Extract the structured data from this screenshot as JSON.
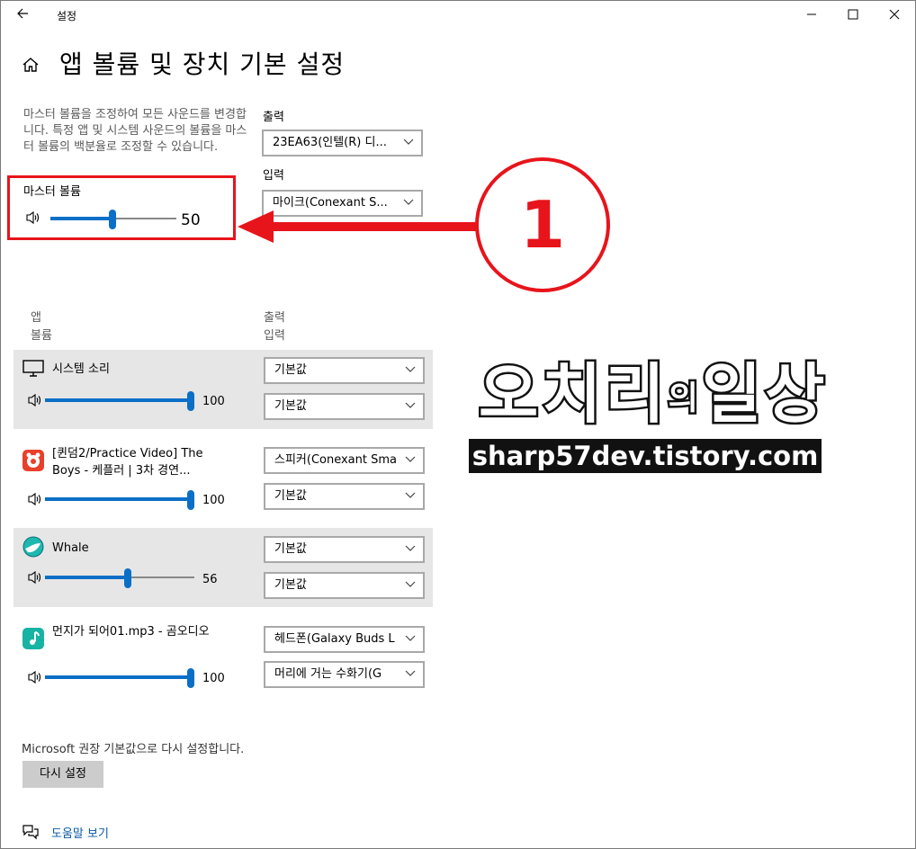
{
  "window": {
    "title": "설정",
    "back_icon": "arrow-left-icon",
    "minimize_glyph": "—",
    "maximize_glyph": "☐",
    "close_glyph": "✕"
  },
  "page": {
    "title": "앱 볼륨 및 장치 기본 설정",
    "home_icon": "home-icon"
  },
  "master": {
    "description": "마스터 볼륨을 조정하여 모든 사운드를 변경합니다. 특정 앱 및 시스템 사운드의 볼륨을 마스터 볼륨의 백분율로 조정할 수 있습니다.",
    "label": "마스터 볼륨",
    "value": "50",
    "level_percent": 50
  },
  "devices": {
    "output_label": "출력",
    "output_value": "23EA63(인텔(R) 디...",
    "input_label": "입력",
    "input_value": "마이크(Conexant S..."
  },
  "columns": {
    "app": "앱",
    "volume": "볼륨",
    "output": "출력",
    "input": "입력"
  },
  "apps": [
    {
      "name": "시스템 소리",
      "icon": "monitor-icon",
      "volume": "100",
      "level_percent": 100,
      "output": "기본값",
      "input": "기본값"
    },
    {
      "name": "[퀸덤2/Practice Video] The Boys - 케플러 | 3차 경연...",
      "icon": "gom-player-icon",
      "volume": "100",
      "level_percent": 100,
      "output": "스피커(Conexant Sma",
      "input": "기본값"
    },
    {
      "name": "Whale",
      "icon": "whale-browser-icon",
      "volume": "56",
      "level_percent": 56,
      "output": "기본값",
      "input": "기본값"
    },
    {
      "name": "먼지가 되어01.mp3 - 곰오디오",
      "icon": "music-note-icon",
      "volume": "100",
      "level_percent": 100,
      "output": "헤드폰(Galaxy Buds L",
      "input": "머리에 거는 수화기(G"
    }
  ],
  "reset": {
    "note": "Microsoft 권장 기본값으로 다시 설정합니다.",
    "button": "다시 설정"
  },
  "help": {
    "label": "도움말 보기",
    "icon": "help-chat-icon"
  },
  "annotation": {
    "number": "1",
    "color": "#e8141b"
  },
  "watermark": {
    "title_a": "오치리",
    "title_mid": "의",
    "title_b": "일상",
    "url": "sharp57dev.tistory.com"
  },
  "colors": {
    "accent": "#0a6fc7",
    "row_highlight": "#e6e6e6",
    "annotation_red": "#e8141b"
  }
}
